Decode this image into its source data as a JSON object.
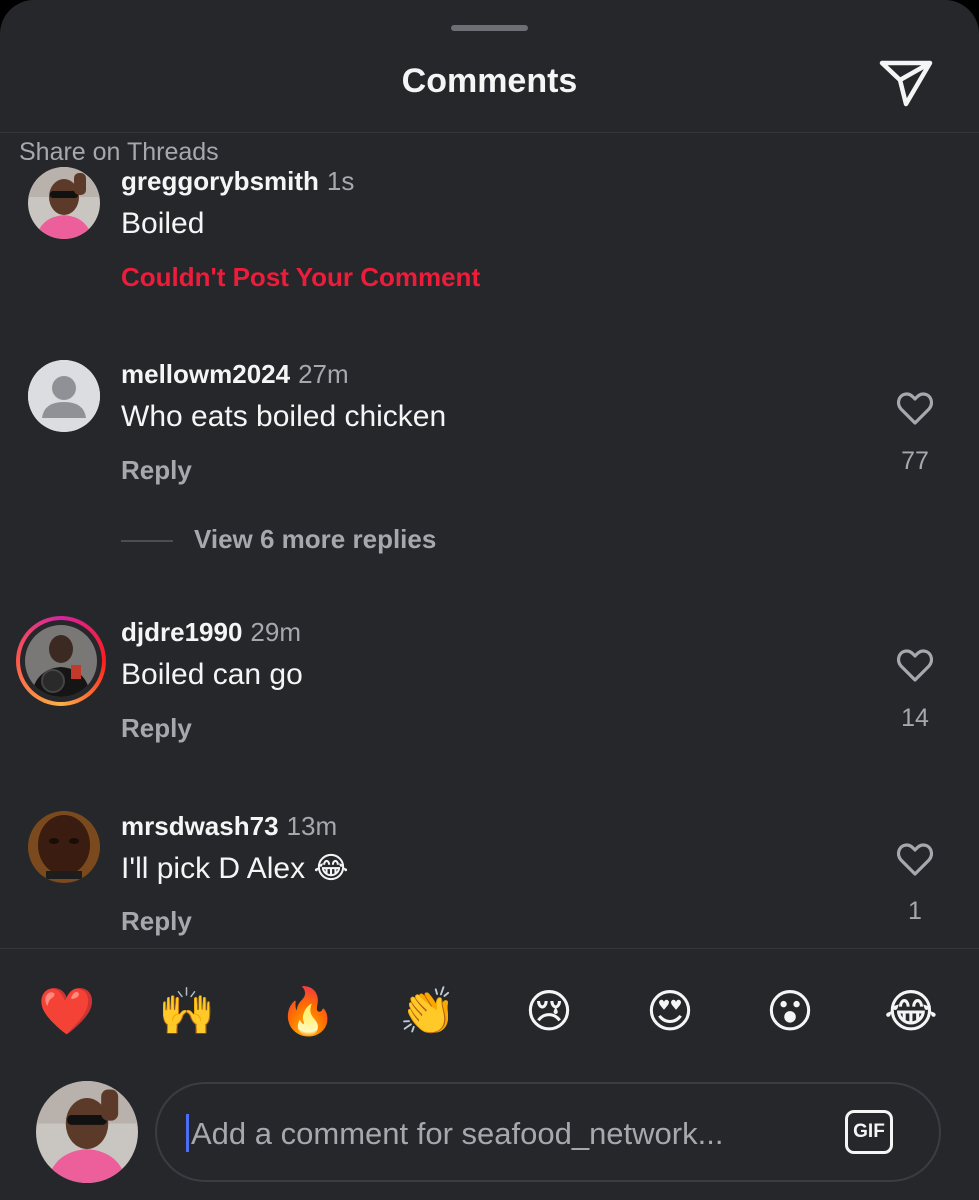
{
  "header": {
    "title": "Comments",
    "share_icon": "paper-plane-icon"
  },
  "threads": {
    "label": "Share on Threads"
  },
  "comments": [
    {
      "username": "greggorybsmith",
      "time": "1s",
      "text": "Boiled",
      "status": "Couldn't Post Your Comment"
    },
    {
      "username": "mellowm2024",
      "time": "27m",
      "text": "Who eats boiled chicken",
      "reply": "Reply",
      "likes": "77",
      "view_more": "View 6 more replies"
    },
    {
      "username": "djdre1990",
      "time": "29m",
      "text": "Boiled can go",
      "reply": "Reply",
      "likes": "14"
    },
    {
      "username": "mrsdwash73",
      "time": "13m",
      "text": "I'll pick D Alex 😂",
      "reply": "Reply",
      "likes": "1"
    }
  ],
  "reactions": [
    "❤️",
    "🙌",
    "🔥",
    "👏",
    "😢",
    "😍",
    "😮",
    "😂"
  ],
  "composer": {
    "placeholder": "Add a comment for seafood_network...",
    "gif_label": "GIF"
  },
  "colors": {
    "background": "#25272b",
    "error": "#ed1c3a",
    "secondary_text": "#a6a8ad",
    "caret": "#4c6ef5"
  }
}
